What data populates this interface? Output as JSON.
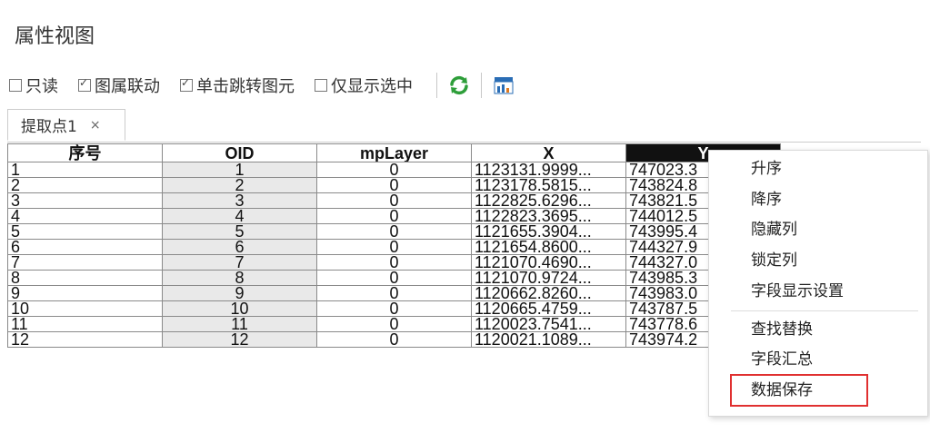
{
  "panel": {
    "title": "属性视图"
  },
  "toolbar": {
    "readonly": {
      "label": "只读",
      "checked": false
    },
    "map_link": {
      "label": "图属联动",
      "checked": true
    },
    "click_jump": {
      "label": "单击跳转图元",
      "checked": true
    },
    "show_selected": {
      "label": "仅显示选中",
      "checked": false
    },
    "refresh_icon": "refresh-icon",
    "chart_icon": "table-chart-icon"
  },
  "tab": {
    "label": "提取点1",
    "close": "×"
  },
  "grid": {
    "columns": [
      "序号",
      "OID",
      "mpLayer",
      "X",
      "Y"
    ],
    "rows": [
      [
        "1",
        "1",
        "0",
        "1123131.9999...",
        "747023.3"
      ],
      [
        "2",
        "2",
        "0",
        "1123178.5815...",
        "743824.8"
      ],
      [
        "3",
        "3",
        "0",
        "1122825.6296...",
        "743821.5"
      ],
      [
        "4",
        "4",
        "0",
        "1122823.3695...",
        "744012.5"
      ],
      [
        "5",
        "5",
        "0",
        "1121655.3904...",
        "743995.4"
      ],
      [
        "6",
        "6",
        "0",
        "1121654.8600...",
        "744327.9"
      ],
      [
        "7",
        "7",
        "0",
        "1121070.4690...",
        "744327.0"
      ],
      [
        "8",
        "8",
        "0",
        "1121070.9724...",
        "743985.3"
      ],
      [
        "9",
        "9",
        "0",
        "1120662.8260...",
        "743983.0"
      ],
      [
        "10",
        "10",
        "0",
        "1120665.4759...",
        "743787.5"
      ],
      [
        "11",
        "11",
        "0",
        "1120023.7541...",
        "743778.6"
      ],
      [
        "12",
        "12",
        "0",
        "1120021.1089...",
        "743974.2"
      ]
    ]
  },
  "context_menu": {
    "items": [
      "升序",
      "降序",
      "隐藏列",
      "锁定列",
      "字段显示设置",
      "查找替换",
      "字段汇总",
      "数据保存"
    ]
  },
  "colors": {
    "accent_highlight": "#e03030",
    "selected_header": "#111111",
    "refresh_green": "#2e9e3a"
  }
}
